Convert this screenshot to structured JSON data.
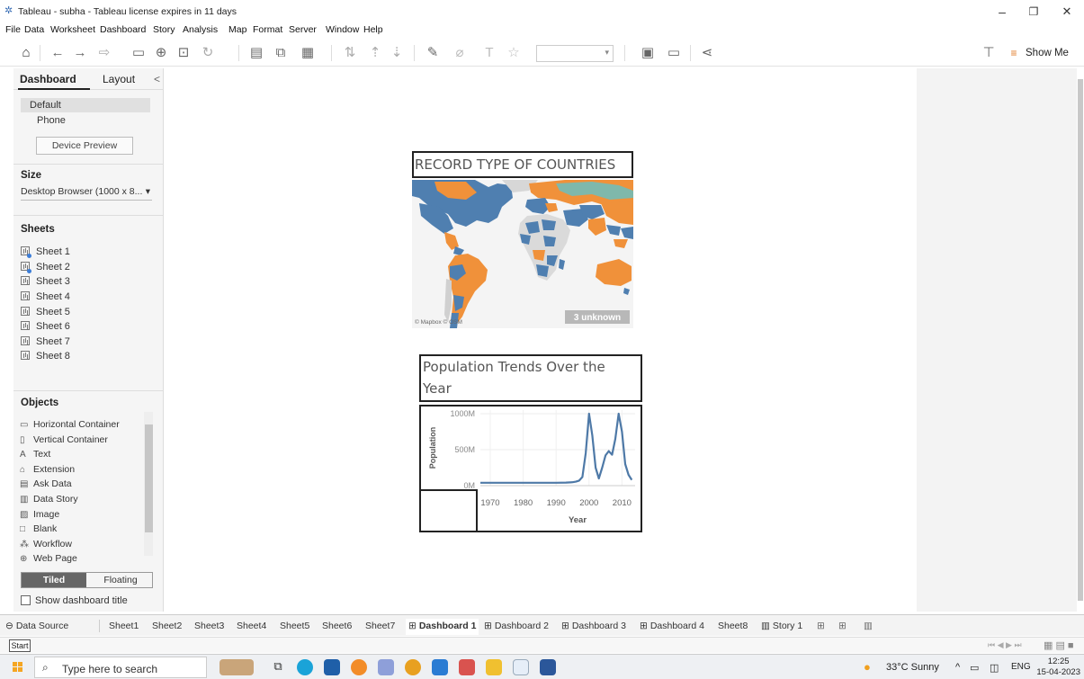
{
  "window": {
    "title": "Tableau - subha - Tableau license expires in 11 days",
    "controls": {
      "minimize": "–",
      "restore": "❐",
      "close": "✕"
    }
  },
  "menu": [
    "File",
    "Data",
    "Worksheet",
    "Dashboard",
    "Story",
    "Analysis",
    "Map",
    "Format",
    "Server",
    "Window",
    "Help"
  ],
  "toolbar": {
    "show_me": "Show Me"
  },
  "left_pane": {
    "tabs": {
      "dashboard": "Dashboard",
      "layout": "Layout",
      "collapse": "<"
    },
    "devices": {
      "default": "Default",
      "phone": "Phone"
    },
    "device_preview": "Device Preview",
    "size": {
      "title": "Size",
      "value": "Desktop Browser (1000 x 8...",
      "arrow": "▾"
    },
    "sheets": {
      "title": "Sheets",
      "items": [
        "Sheet 1",
        "Sheet 2",
        "Sheet 3",
        "Sheet 4",
        "Sheet 5",
        "Sheet 6",
        "Sheet 7",
        "Sheet 8"
      ]
    },
    "objects": {
      "title": "Objects",
      "items": [
        "Horizontal Container",
        "Vertical Container",
        "Text",
        "Extension",
        "Ask Data",
        "Data Story",
        "Image",
        "Blank",
        "Workflow",
        "Web Page"
      ]
    },
    "tiled": "Tiled",
    "floating": "Floating",
    "show_title": "Show dashboard title"
  },
  "dashboard": {
    "map_title": "RECORD TYPE OF COUNTRIES",
    "map_attribution": "© Mapbox © OSM",
    "map_unknown": "3 unknown",
    "pop_title_line1": "Population Trends Over the",
    "pop_title_line2": "Year"
  },
  "colors": {
    "orange": "#f0913a",
    "blue": "#4f7fb0",
    "teal": "#7fb8ab",
    "grey": "#d9d9d9",
    "line": "#4e79a7"
  },
  "chart_data": {
    "type": "line",
    "title": "Population Trends Over the Year",
    "xlabel": "Year",
    "ylabel": "Population",
    "xticks": [
      "1970",
      "1980",
      "1990",
      "2000",
      "2010"
    ],
    "yticks": [
      "1000M",
      "500M",
      "0M"
    ],
    "ylim": [
      0,
      1050
    ],
    "xlim": [
      1967,
      2014
    ],
    "grid": true,
    "series": [
      {
        "name": "Population",
        "x": [
          1967,
          1970,
          1975,
          1980,
          1985,
          1990,
          1993,
          1995,
          1996,
          1997,
          1998,
          1999,
          2000,
          2001,
          2002,
          2003,
          2004,
          2005,
          2006,
          2007,
          2008,
          2009,
          2010,
          2011,
          2012,
          2013
        ],
        "values": [
          40,
          40,
          40,
          40,
          40,
          40,
          42,
          48,
          55,
          70,
          120,
          450,
          1000,
          700,
          250,
          100,
          250,
          420,
          480,
          430,
          650,
          1000,
          750,
          300,
          150,
          80
        ]
      }
    ]
  },
  "bottom_tabs": [
    "Data Source",
    "Sheet1",
    "Sheet2",
    "Sheet3",
    "Sheet4",
    "Sheet5",
    "Sheet6",
    "Sheet7",
    "Dashboard 1",
    "Dashboard 2",
    "Dashboard 3",
    "Dashboard 4",
    "Sheet8",
    "Story 1"
  ],
  "active_tab": "Dashboard 1",
  "status": {
    "start": "Start"
  },
  "taskbar": {
    "search_placeholder": "Type here to search",
    "weather": "33°C  Sunny",
    "lang": "ENG",
    "time": "12:25",
    "date": "15-04-2023"
  }
}
